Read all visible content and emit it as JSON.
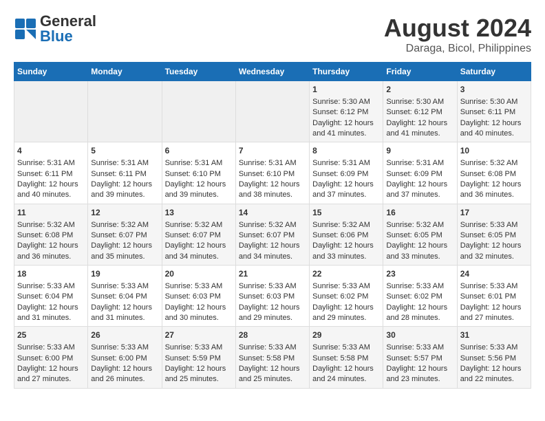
{
  "logo": {
    "general": "General",
    "blue": "Blue"
  },
  "title": "August 2024",
  "subtitle": "Daraga, Bicol, Philippines",
  "weekdays": [
    "Sunday",
    "Monday",
    "Tuesday",
    "Wednesday",
    "Thursday",
    "Friday",
    "Saturday"
  ],
  "weeks": [
    [
      {
        "day": "",
        "content": ""
      },
      {
        "day": "",
        "content": ""
      },
      {
        "day": "",
        "content": ""
      },
      {
        "day": "",
        "content": ""
      },
      {
        "day": "1",
        "content": "Sunrise: 5:30 AM\nSunset: 6:12 PM\nDaylight: 12 hours\nand 41 minutes."
      },
      {
        "day": "2",
        "content": "Sunrise: 5:30 AM\nSunset: 6:12 PM\nDaylight: 12 hours\nand 41 minutes."
      },
      {
        "day": "3",
        "content": "Sunrise: 5:30 AM\nSunset: 6:11 PM\nDaylight: 12 hours\nand 40 minutes."
      }
    ],
    [
      {
        "day": "4",
        "content": "Sunrise: 5:31 AM\nSunset: 6:11 PM\nDaylight: 12 hours\nand 40 minutes."
      },
      {
        "day": "5",
        "content": "Sunrise: 5:31 AM\nSunset: 6:11 PM\nDaylight: 12 hours\nand 39 minutes."
      },
      {
        "day": "6",
        "content": "Sunrise: 5:31 AM\nSunset: 6:10 PM\nDaylight: 12 hours\nand 39 minutes."
      },
      {
        "day": "7",
        "content": "Sunrise: 5:31 AM\nSunset: 6:10 PM\nDaylight: 12 hours\nand 38 minutes."
      },
      {
        "day": "8",
        "content": "Sunrise: 5:31 AM\nSunset: 6:09 PM\nDaylight: 12 hours\nand 37 minutes."
      },
      {
        "day": "9",
        "content": "Sunrise: 5:31 AM\nSunset: 6:09 PM\nDaylight: 12 hours\nand 37 minutes."
      },
      {
        "day": "10",
        "content": "Sunrise: 5:32 AM\nSunset: 6:08 PM\nDaylight: 12 hours\nand 36 minutes."
      }
    ],
    [
      {
        "day": "11",
        "content": "Sunrise: 5:32 AM\nSunset: 6:08 PM\nDaylight: 12 hours\nand 36 minutes."
      },
      {
        "day": "12",
        "content": "Sunrise: 5:32 AM\nSunset: 6:07 PM\nDaylight: 12 hours\nand 35 minutes."
      },
      {
        "day": "13",
        "content": "Sunrise: 5:32 AM\nSunset: 6:07 PM\nDaylight: 12 hours\nand 34 minutes."
      },
      {
        "day": "14",
        "content": "Sunrise: 5:32 AM\nSunset: 6:07 PM\nDaylight: 12 hours\nand 34 minutes."
      },
      {
        "day": "15",
        "content": "Sunrise: 5:32 AM\nSunset: 6:06 PM\nDaylight: 12 hours\nand 33 minutes."
      },
      {
        "day": "16",
        "content": "Sunrise: 5:32 AM\nSunset: 6:05 PM\nDaylight: 12 hours\nand 33 minutes."
      },
      {
        "day": "17",
        "content": "Sunrise: 5:33 AM\nSunset: 6:05 PM\nDaylight: 12 hours\nand 32 minutes."
      }
    ],
    [
      {
        "day": "18",
        "content": "Sunrise: 5:33 AM\nSunset: 6:04 PM\nDaylight: 12 hours\nand 31 minutes."
      },
      {
        "day": "19",
        "content": "Sunrise: 5:33 AM\nSunset: 6:04 PM\nDaylight: 12 hours\nand 31 minutes."
      },
      {
        "day": "20",
        "content": "Sunrise: 5:33 AM\nSunset: 6:03 PM\nDaylight: 12 hours\nand 30 minutes."
      },
      {
        "day": "21",
        "content": "Sunrise: 5:33 AM\nSunset: 6:03 PM\nDaylight: 12 hours\nand 29 minutes."
      },
      {
        "day": "22",
        "content": "Sunrise: 5:33 AM\nSunset: 6:02 PM\nDaylight: 12 hours\nand 29 minutes."
      },
      {
        "day": "23",
        "content": "Sunrise: 5:33 AM\nSunset: 6:02 PM\nDaylight: 12 hours\nand 28 minutes."
      },
      {
        "day": "24",
        "content": "Sunrise: 5:33 AM\nSunset: 6:01 PM\nDaylight: 12 hours\nand 27 minutes."
      }
    ],
    [
      {
        "day": "25",
        "content": "Sunrise: 5:33 AM\nSunset: 6:00 PM\nDaylight: 12 hours\nand 27 minutes."
      },
      {
        "day": "26",
        "content": "Sunrise: 5:33 AM\nSunset: 6:00 PM\nDaylight: 12 hours\nand 26 minutes."
      },
      {
        "day": "27",
        "content": "Sunrise: 5:33 AM\nSunset: 5:59 PM\nDaylight: 12 hours\nand 25 minutes."
      },
      {
        "day": "28",
        "content": "Sunrise: 5:33 AM\nSunset: 5:58 PM\nDaylight: 12 hours\nand 25 minutes."
      },
      {
        "day": "29",
        "content": "Sunrise: 5:33 AM\nSunset: 5:58 PM\nDaylight: 12 hours\nand 24 minutes."
      },
      {
        "day": "30",
        "content": "Sunrise: 5:33 AM\nSunset: 5:57 PM\nDaylight: 12 hours\nand 23 minutes."
      },
      {
        "day": "31",
        "content": "Sunrise: 5:33 AM\nSunset: 5:56 PM\nDaylight: 12 hours\nand 22 minutes."
      }
    ]
  ]
}
